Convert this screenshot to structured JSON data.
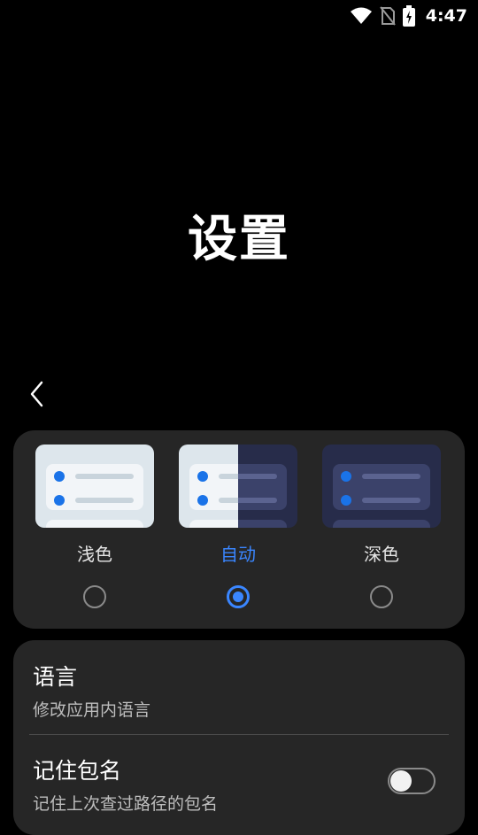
{
  "status_bar": {
    "time": "4:47",
    "icons": [
      "wifi-icon",
      "no-sim-icon",
      "battery-charging-icon"
    ]
  },
  "header": {
    "title": "设置",
    "back_icon": "chevron-left-icon"
  },
  "theme": {
    "options": [
      {
        "label": "浅色",
        "selected": false
      },
      {
        "label": "自动",
        "selected": true
      },
      {
        "label": "深色",
        "selected": false
      }
    ],
    "accent_color": "#3a86ff"
  },
  "settings": {
    "language": {
      "title": "语言",
      "subtitle": "修改应用内语言"
    },
    "remember_package": {
      "title": "记住包名",
      "subtitle": "记住上次查过路径的包名",
      "toggle_on": false
    }
  }
}
